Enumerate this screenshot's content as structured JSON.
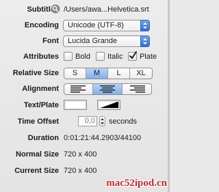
{
  "subtitles": {
    "label": "Subtitles",
    "path": "/Users/awa...Helvetica.srt"
  },
  "encoding": {
    "label": "Encoding",
    "value": "Unicode (UTF-8)"
  },
  "font": {
    "label": "Font",
    "value": "Lucida Grande"
  },
  "attributes": {
    "label": "Attributes",
    "bold": {
      "label": "Bold",
      "checked": false
    },
    "italic": {
      "label": "Italic",
      "checked": false
    },
    "plate": {
      "label": "Plate",
      "checked": true
    }
  },
  "relative_size": {
    "label": "Relative Size",
    "options": [
      "S",
      "M",
      "L",
      "XL"
    ],
    "selected": "M"
  },
  "alignment": {
    "label": "Alignment",
    "options": [
      "left",
      "center",
      "right"
    ],
    "selected": "center"
  },
  "text_plate": {
    "label": "Text/Plate",
    "text_color": "#ffffff",
    "plate_color": "#000000"
  },
  "time_offset": {
    "label": "Time Offset",
    "value": "0,0",
    "unit": "seconds"
  },
  "duration": {
    "label": "Duration",
    "value": "0:01:21:44.2903/44100"
  },
  "normal_size": {
    "label": "Normal Size",
    "value": "720 x 400"
  },
  "current_size": {
    "label": "Current Size",
    "value": "720 x 400"
  },
  "watermark": "mac52ipod.cn",
  "colors": {
    "accent": "#2f6fd6",
    "selected_segment": "#8fbaf0",
    "watermark": "#c8242a"
  }
}
